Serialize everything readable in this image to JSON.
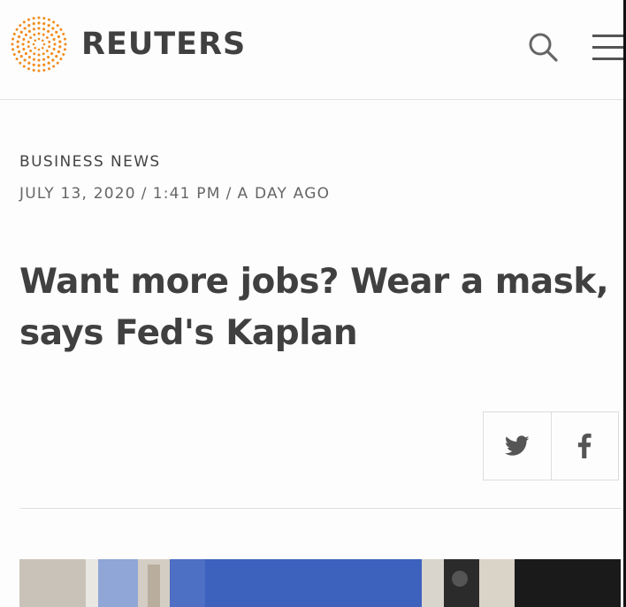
{
  "header": {
    "brand": "REUTERS",
    "logo_icon": "reuters-dot-logo-icon",
    "search_icon": "search-icon",
    "menu_icon": "hamburger-menu-icon",
    "logo_color": "#f28c1e"
  },
  "article": {
    "section": "BUSINESS NEWS",
    "date": "JULY 13, 2020",
    "time": "1:41 PM",
    "relative": "A DAY AGO",
    "separator": "/",
    "headline": "Want more jobs? Wear a mask, says Fed's Kaplan"
  },
  "share": {
    "twitter_icon": "twitter-icon",
    "facebook_icon": "facebook-icon"
  }
}
